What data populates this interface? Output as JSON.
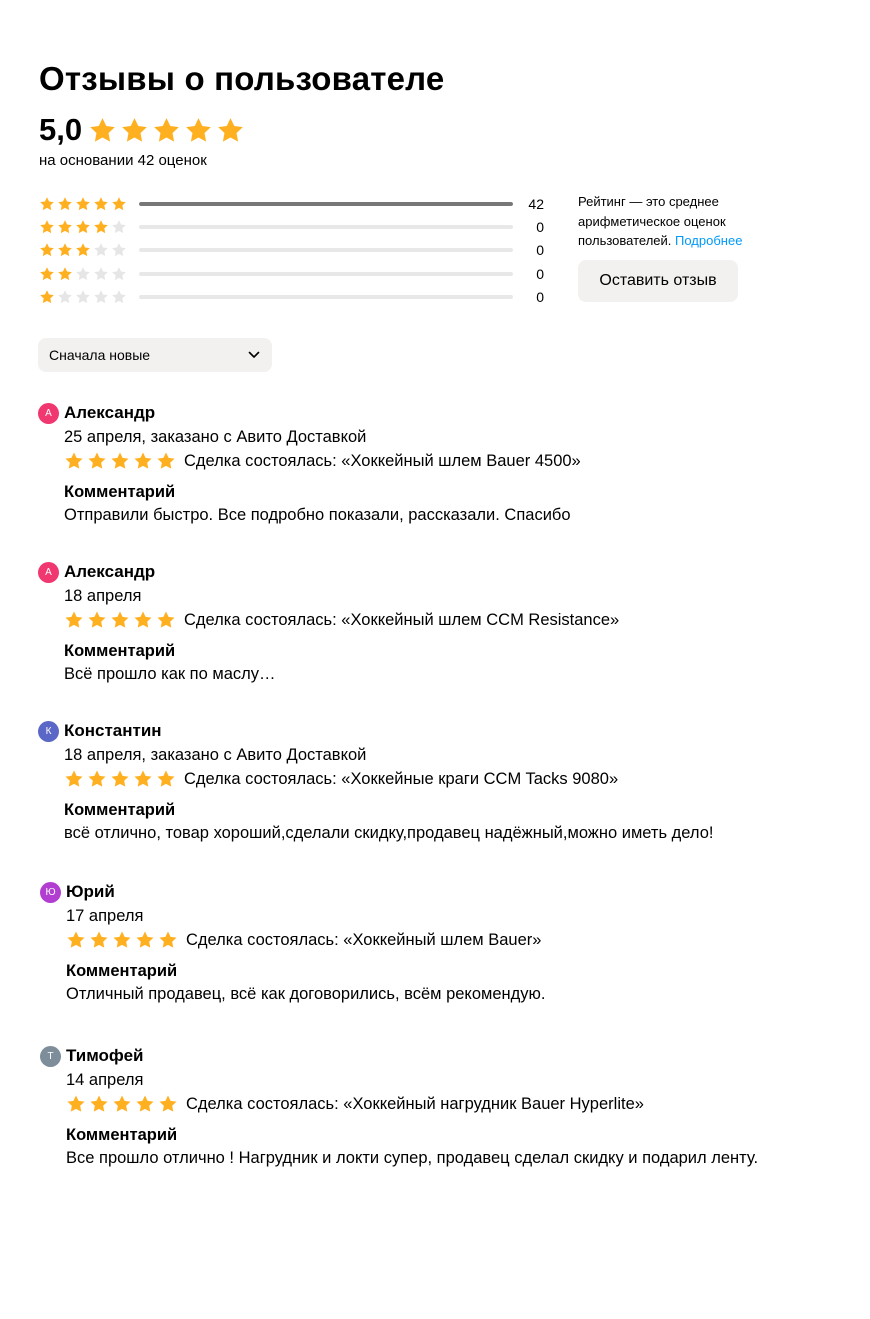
{
  "header": {
    "title": "Отзывы о пользователе",
    "score": "5,0",
    "basis": "на основании 42 оценок"
  },
  "colors": {
    "star_on": "#ffb021",
    "star_off": "#e6e6e6",
    "link": "#0099f7",
    "bar_fill": "#777777",
    "bar_track": "#e8e8e8"
  },
  "distribution": [
    {
      "stars": 5,
      "count": "42",
      "fraction": 1.0
    },
    {
      "stars": 4,
      "count": "0",
      "fraction": 0.0
    },
    {
      "stars": 3,
      "count": "0",
      "fraction": 0.0
    },
    {
      "stars": 2,
      "count": "0",
      "fraction": 0.0
    },
    {
      "stars": 1,
      "count": "0",
      "fraction": 0.0
    }
  ],
  "info": {
    "text": "Рейтинг — это среднее арифметическое оценок пользователей.",
    "more_link": "Подробнее",
    "leave_review_button": "Оставить отзыв"
  },
  "sort": {
    "selected": "Сначала новые"
  },
  "reviews": [
    {
      "initial": "А",
      "avatar_color": "#f0376f",
      "name": "Александр",
      "date": "25 апреля, заказано с Авито Доставкой",
      "rating": 5,
      "deal": "Сделка состоялась: «Хоккейный шлем Bauer 4500»",
      "comment_label": "Комментарий",
      "comment": "Отправили быстро. Все подробно показали, рассказали. Спасибо"
    },
    {
      "initial": "А",
      "avatar_color": "#f0376f",
      "name": "Александр",
      "date": "18 апреля",
      "rating": 5,
      "deal": "Сделка состоялась: «Хоккейный шлем CCM Resistance»",
      "comment_label": "Комментарий",
      "comment": "Всё прошло как по маслу…"
    },
    {
      "initial": "К",
      "avatar_color": "#5b67c7",
      "name": "Константин",
      "date": "18 апреля, заказано с Авито Доставкой",
      "rating": 5,
      "deal": "Сделка состоялась: «Хоккейные краги CCM Tacks 9080»",
      "comment_label": "Комментарий",
      "comment": "всё отлично, товар хороший,сделали скидку,продавец надёжный,можно иметь дело!"
    },
    {
      "initial": "Ю",
      "avatar_color": "#b13ed1",
      "name": "Юрий",
      "date": "17 апреля",
      "rating": 5,
      "deal": "Сделка состоялась: «Хоккейный шлем Bauer»",
      "comment_label": "Комментарий",
      "comment": "Отличный продавец, всё как договорились, всём рекомендую."
    },
    {
      "initial": "Т",
      "avatar_color": "#7d8d99",
      "name": "Тимофей",
      "date": "14 апреля",
      "rating": 5,
      "deal": "Сделка состоялась: «Хоккейный нагрудник Bauer Hyperlite»",
      "comment_label": "Комментарий",
      "comment": "Все прошло отлично ! Нагрудник и локти супер, продавец сделал скидку и подарил ленту."
    }
  ]
}
